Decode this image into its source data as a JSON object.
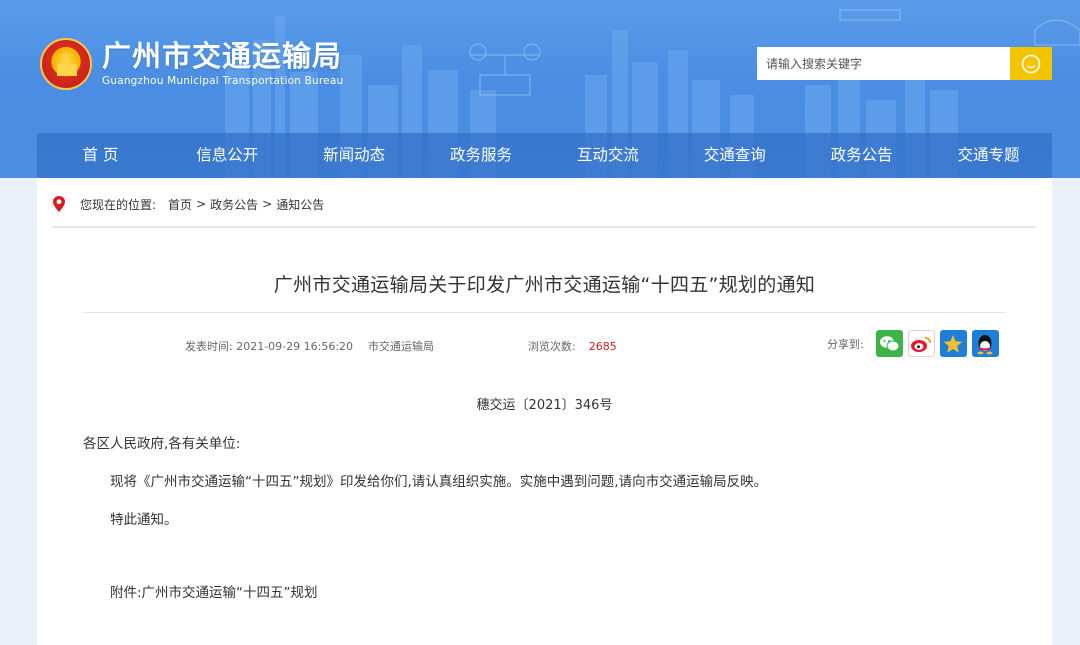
{
  "site": {
    "name_cn": "广州市交通运输局",
    "name_en": "Guangzhou Municipal Transportation Bureau"
  },
  "search": {
    "placeholder": "请输入搜索关键字"
  },
  "nav": {
    "items": [
      "首 页",
      "信息公开",
      "新闻动态",
      "政务服务",
      "互动交流",
      "交通查询",
      "政务公告",
      "交通专题"
    ]
  },
  "breadcrumb": {
    "prefix": "您现在的位置:",
    "items": [
      "首页",
      "政务公告",
      "通知公告"
    ],
    "separator": ">"
  },
  "article": {
    "title": "广州市交通运输局关于印发广州市交通运输“十四五”规划的通知",
    "publish_label": "发表时间:",
    "publish_time": "2021-09-29 16:56:20",
    "source": "市交通运输局",
    "views_label": "浏览次数:",
    "views": "2685",
    "share_label": "分享到:",
    "doc_number": "穗交运〔2021〕346号",
    "salutation": "各区人民政府,各有关单位:",
    "body": "现将《广州市交通运输“十四五”规划》印发给你们,请认真组织实施。实施中遇到问题,请向市交通运输局反映。",
    "closing": "特此通知。",
    "attachment": "附件:广州市交通运输“十四五”规划"
  },
  "share_icons": [
    "wechat-icon",
    "weibo-icon",
    "qzone-icon",
    "qq-icon"
  ],
  "colors": {
    "header_blue": "#4a8de2",
    "nav_blue": "#3270c8",
    "search_button": "#f2c500",
    "views_red": "#d61c1c",
    "wechat": "#3bb54a",
    "weibo": "#e6162d",
    "qzone": "#1f7fd6",
    "qq": "#1f7fd6"
  }
}
